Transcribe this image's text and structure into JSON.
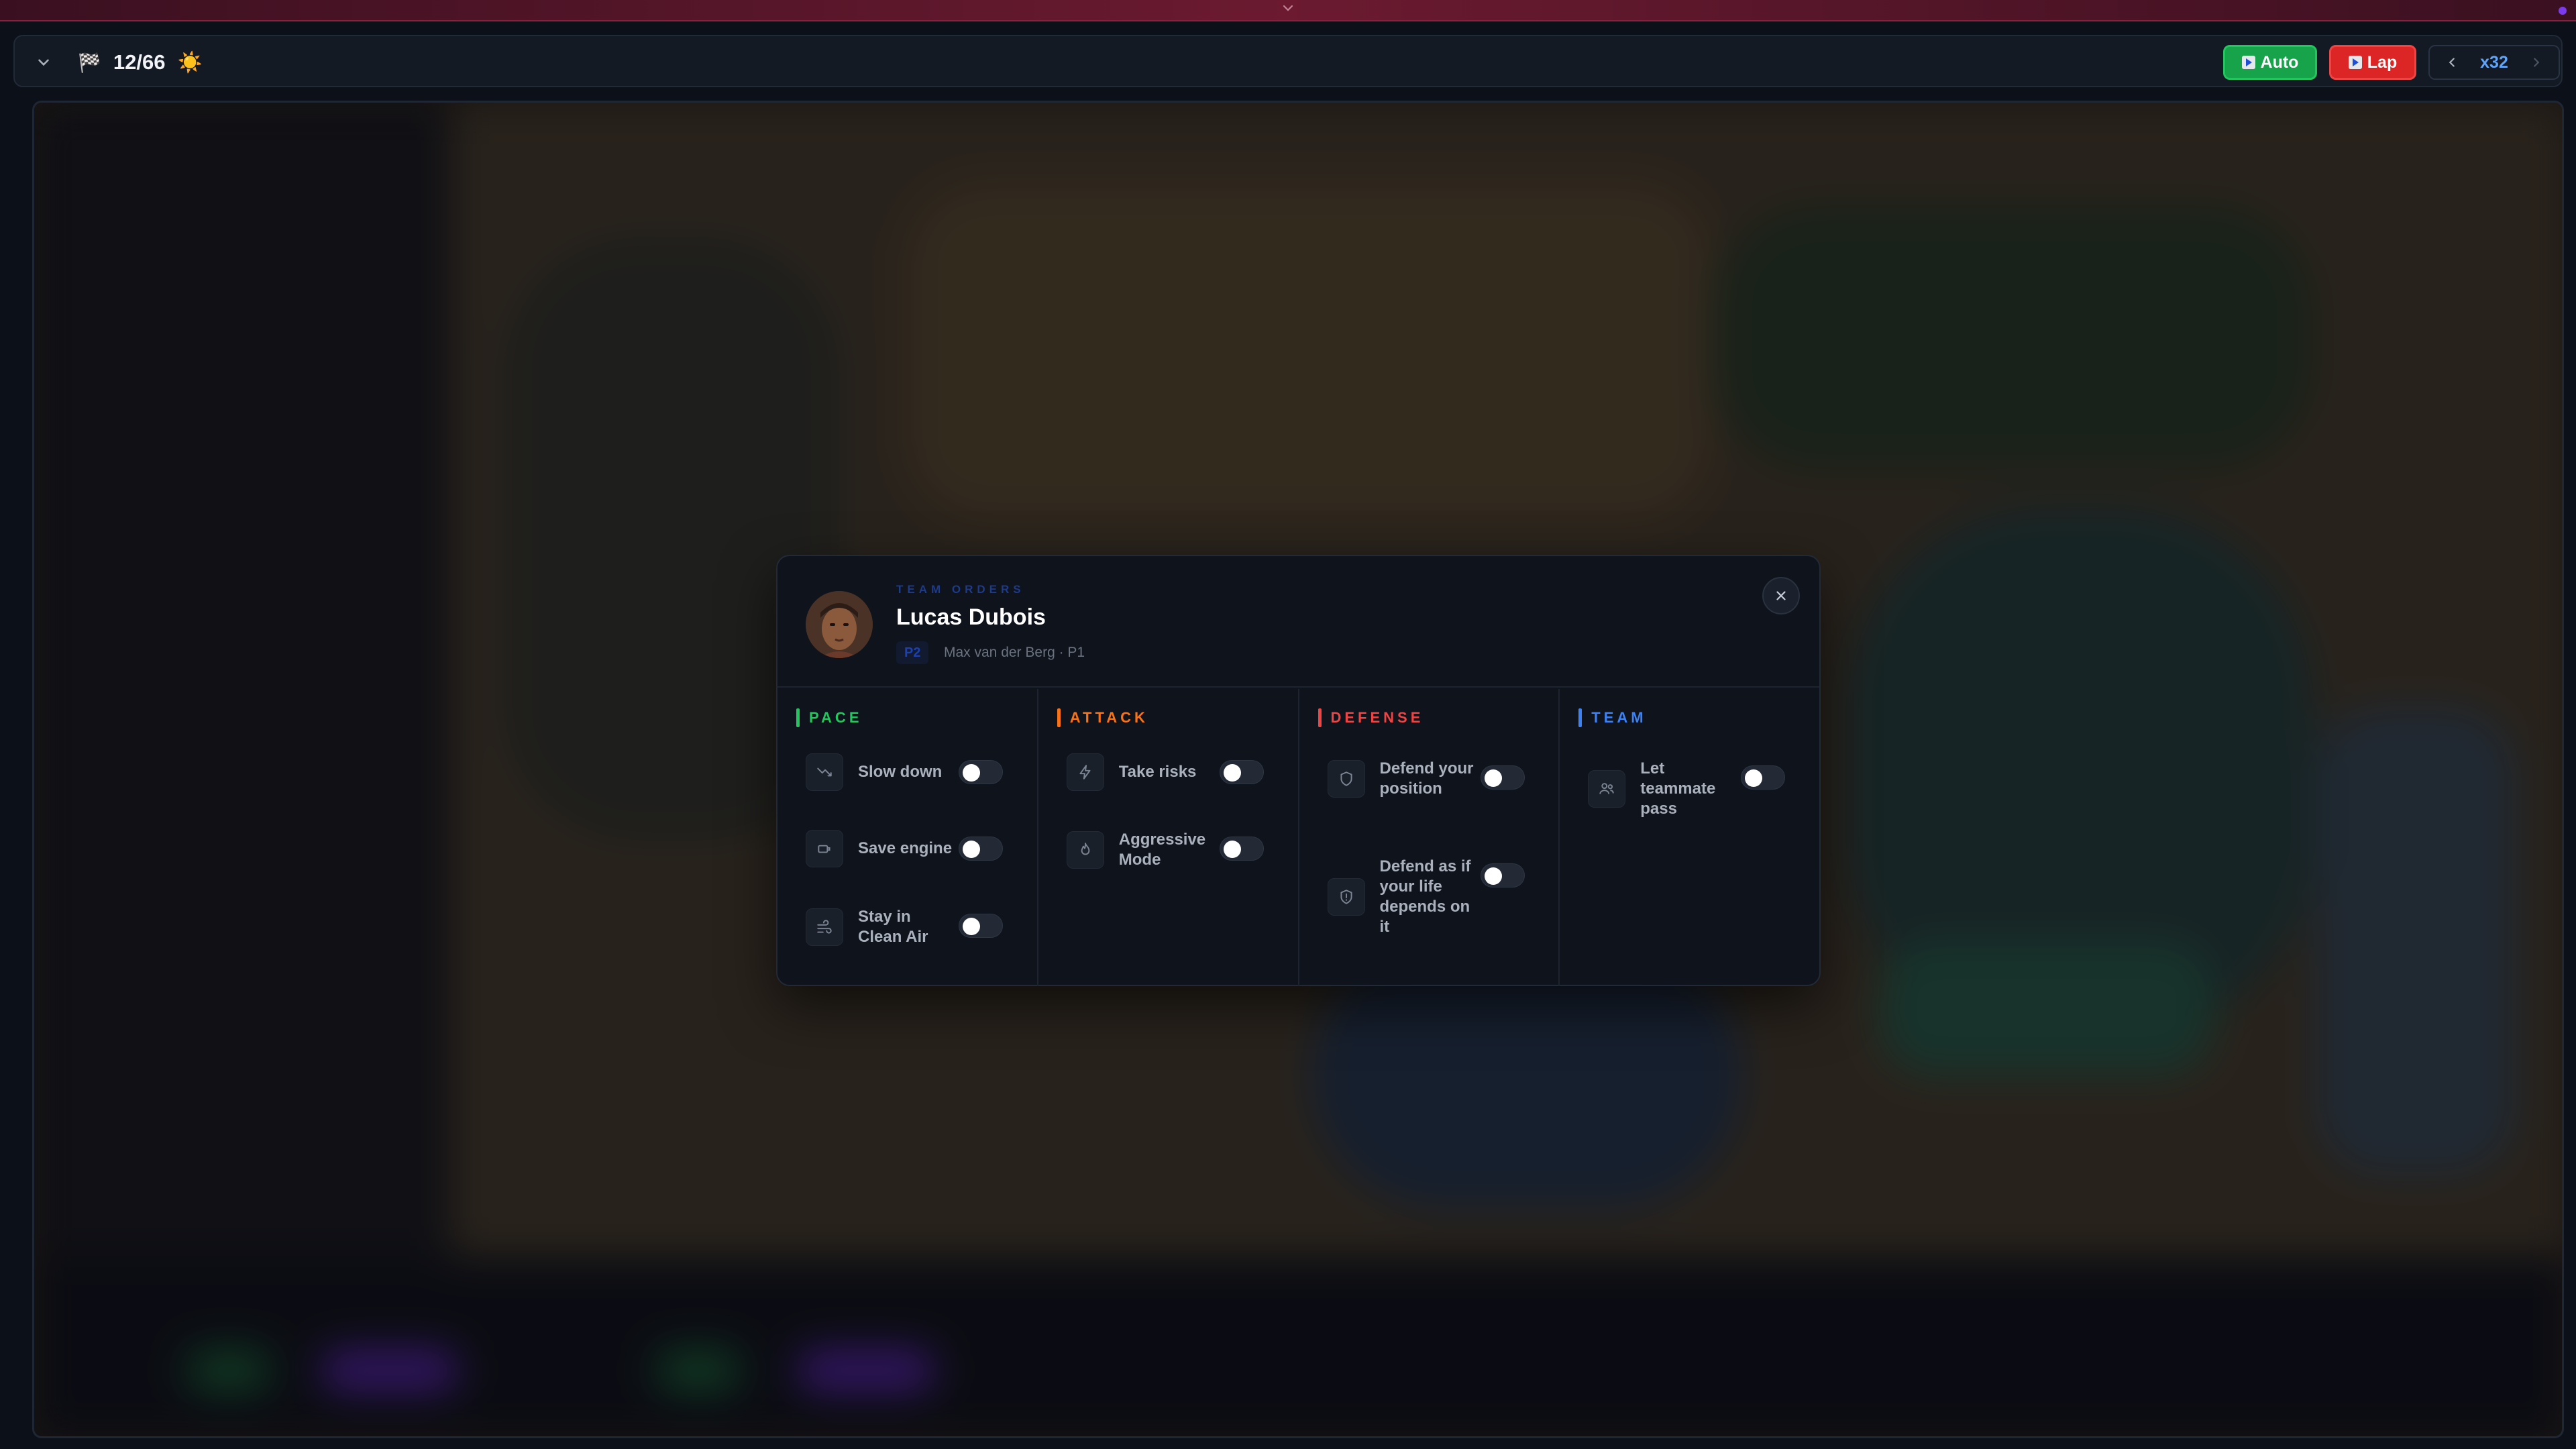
{
  "toolbar": {
    "lap_counter": "12/66",
    "flag_glyph": "🏁",
    "weather_glyph": "☀️",
    "auto_label": "Auto",
    "lap_label": "Lap",
    "speed_label": "x32"
  },
  "modal": {
    "eyebrow": "TEAM ORDERS",
    "driver_name": "Lucas Dubois",
    "position_badge": "P2",
    "subinfo": "Max van der Berg · P1",
    "sections": {
      "pace": {
        "title": "PACE",
        "color": "#22c55e",
        "options": [
          {
            "label": "Slow down",
            "icon": "trend-down-icon",
            "enabled": false
          },
          {
            "label": "Save engine",
            "icon": "engine-icon",
            "enabled": false
          },
          {
            "label": "Stay in Clean Air",
            "icon": "wind-icon",
            "enabled": false
          }
        ]
      },
      "attack": {
        "title": "ATTACK",
        "color": "#f97316",
        "options": [
          {
            "label": "Take risks",
            "icon": "lightning-icon",
            "enabled": false
          },
          {
            "label": "Aggressive Mode",
            "icon": "flame-icon",
            "enabled": false
          }
        ]
      },
      "defense": {
        "title": "DEFENSE",
        "color": "#ef4444",
        "options": [
          {
            "label": "Defend your position",
            "icon": "shield-icon",
            "enabled": false
          },
          {
            "label": "Defend as if your life depends on it",
            "icon": "shield-alert-icon",
            "enabled": false
          }
        ]
      },
      "team": {
        "title": "TEAM",
        "color": "#3b82f6",
        "options": [
          {
            "label": "Let teammate pass",
            "icon": "users-icon",
            "enabled": false
          }
        ]
      }
    }
  }
}
